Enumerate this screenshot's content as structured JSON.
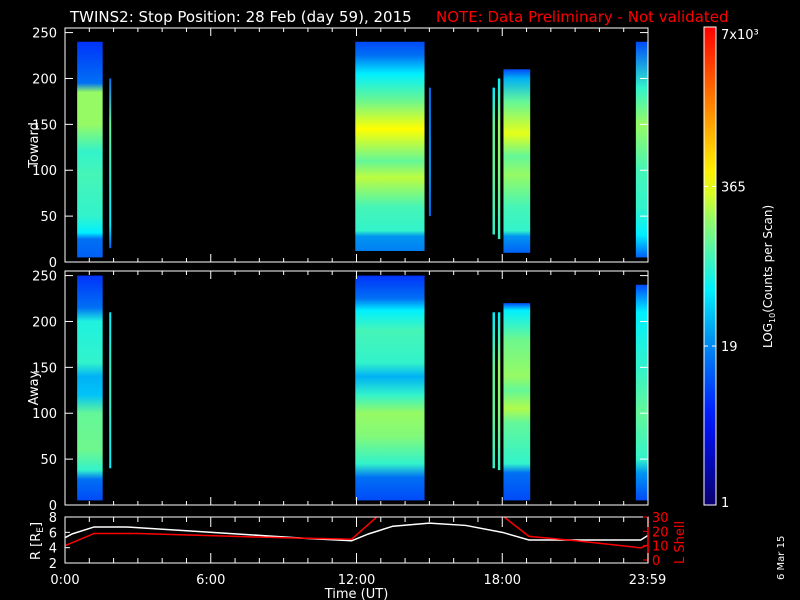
{
  "title": "TWINS2: Stop Position: 28 Feb (day  59), 2015",
  "note": "NOTE: Data Preliminary - Not validated",
  "date_stamp": "6 Mar 15",
  "colors": {
    "note": "#ff0000",
    "axes": "#ffffff",
    "lshell": "#ff0000",
    "radius": "#ffffff"
  },
  "chart_data": [
    {
      "type": "heatmap",
      "panel": "Toward",
      "ylabel": "Toward",
      "ylim": [
        0,
        255
      ],
      "yticks": [
        0,
        50,
        100,
        150,
        200,
        250
      ],
      "xlim_hours": [
        0,
        24
      ],
      "segments": [
        {
          "start": 0.5,
          "end": 1.55,
          "profile": [
            [
              5,
              0.28
            ],
            [
              25,
              0.3
            ],
            [
              32,
              0.45
            ],
            [
              50,
              0.5
            ],
            [
              95,
              0.52
            ],
            [
              120,
              0.5
            ],
            [
              150,
              0.6
            ],
            [
              185,
              0.6
            ],
            [
              195,
              0.3
            ],
            [
              240,
              0.22
            ]
          ]
        },
        {
          "start": 1.82,
          "end": 1.9,
          "profile": [
            [
              15,
              0.28
            ],
            [
              40,
              0.45
            ],
            [
              100,
              0.5
            ],
            [
              150,
              0.55
            ],
            [
              200,
              0.3
            ]
          ]
        },
        {
          "start": 11.95,
          "end": 14.8,
          "profile": [
            [
              12,
              0.32
            ],
            [
              28,
              0.35
            ],
            [
              34,
              0.5
            ],
            [
              60,
              0.52
            ],
            [
              92,
              0.63
            ],
            [
              110,
              0.55
            ],
            [
              145,
              0.68
            ],
            [
              175,
              0.56
            ],
            [
              205,
              0.45
            ],
            [
              225,
              0.3
            ],
            [
              240,
              0.25
            ]
          ]
        },
        {
          "start": 14.98,
          "end": 15.05,
          "profile": [
            [
              50,
              0.3
            ],
            [
              100,
              0.35
            ],
            [
              190,
              0.3
            ]
          ]
        },
        {
          "start": 17.6,
          "end": 17.7,
          "profile": [
            [
              30,
              0.5
            ],
            [
              100,
              0.55
            ],
            [
              150,
              0.55
            ],
            [
              190,
              0.45
            ]
          ]
        },
        {
          "start": 17.82,
          "end": 17.92,
          "profile": [
            [
              25,
              0.5
            ],
            [
              100,
              0.58
            ],
            [
              150,
              0.6
            ],
            [
              200,
              0.45
            ]
          ]
        },
        {
          "start": 18.05,
          "end": 19.15,
          "profile": [
            [
              10,
              0.28
            ],
            [
              28,
              0.35
            ],
            [
              34,
              0.5
            ],
            [
              60,
              0.52
            ],
            [
              95,
              0.6
            ],
            [
              115,
              0.55
            ],
            [
              140,
              0.66
            ],
            [
              175,
              0.55
            ],
            [
              200,
              0.38
            ],
            [
              210,
              0.25
            ]
          ]
        },
        {
          "start": 23.5,
          "end": 24,
          "profile": [
            [
              5,
              0.28
            ],
            [
              30,
              0.45
            ],
            [
              60,
              0.5
            ],
            [
              100,
              0.52
            ],
            [
              150,
              0.6
            ],
            [
              190,
              0.5
            ],
            [
              240,
              0.25
            ]
          ]
        }
      ]
    },
    {
      "type": "heatmap",
      "panel": "Away",
      "ylabel": "Away",
      "ylim": [
        0,
        255
      ],
      "yticks": [
        0,
        50,
        100,
        150,
        200,
        250
      ],
      "xlim_hours": [
        0,
        24
      ],
      "segments": [
        {
          "start": 0.5,
          "end": 1.55,
          "profile": [
            [
              5,
              0.25
            ],
            [
              28,
              0.3
            ],
            [
              38,
              0.5
            ],
            [
              60,
              0.56
            ],
            [
              100,
              0.55
            ],
            [
              120,
              0.4
            ],
            [
              140,
              0.38
            ],
            [
              155,
              0.5
            ],
            [
              200,
              0.48
            ],
            [
              215,
              0.3
            ],
            [
              250,
              0.22
            ]
          ]
        },
        {
          "start": 1.82,
          "end": 1.9,
          "profile": [
            [
              40,
              0.45
            ],
            [
              100,
              0.5
            ],
            [
              150,
              0.5
            ],
            [
              210,
              0.45
            ]
          ]
        },
        {
          "start": 11.95,
          "end": 14.8,
          "profile": [
            [
              5,
              0.25
            ],
            [
              30,
              0.3
            ],
            [
              45,
              0.5
            ],
            [
              75,
              0.58
            ],
            [
              100,
              0.6
            ],
            [
              120,
              0.5
            ],
            [
              140,
              0.38
            ],
            [
              155,
              0.5
            ],
            [
              190,
              0.52
            ],
            [
              212,
              0.45
            ],
            [
              225,
              0.3
            ],
            [
              250,
              0.22
            ]
          ]
        },
        {
          "start": 17.6,
          "end": 17.7,
          "profile": [
            [
              40,
              0.5
            ],
            [
              100,
              0.55
            ],
            [
              150,
              0.55
            ],
            [
              210,
              0.45
            ]
          ]
        },
        {
          "start": 17.82,
          "end": 17.92,
          "profile": [
            [
              38,
              0.5
            ],
            [
              100,
              0.58
            ],
            [
              150,
              0.6
            ],
            [
              210,
              0.45
            ]
          ]
        },
        {
          "start": 18.05,
          "end": 19.15,
          "profile": [
            [
              5,
              0.25
            ],
            [
              35,
              0.3
            ],
            [
              45,
              0.5
            ],
            [
              90,
              0.55
            ],
            [
              105,
              0.62
            ],
            [
              125,
              0.55
            ],
            [
              140,
              0.6
            ],
            [
              180,
              0.56
            ],
            [
              212,
              0.45
            ],
            [
              220,
              0.25
            ]
          ]
        },
        {
          "start": 23.5,
          "end": 24,
          "profile": [
            [
              5,
              0.25
            ],
            [
              35,
              0.35
            ],
            [
              50,
              0.5
            ],
            [
              100,
              0.55
            ],
            [
              150,
              0.5
            ],
            [
              210,
              0.45
            ],
            [
              240,
              0.25
            ]
          ]
        }
      ]
    },
    {
      "type": "line",
      "ylabel": "R [R",
      "ylabel_sub": "E",
      "ylabel_close": "]",
      "ylim": [
        2,
        8
      ],
      "yticks": [
        2,
        4,
        6,
        8
      ],
      "y2label": "L Shell",
      "y2lim": [
        0,
        30
      ],
      "y2ticks": [
        0,
        10,
        20,
        30
      ],
      "xlabel": "Time (UT)",
      "xticks": [
        {
          "h": 0,
          "label": "0:00"
        },
        {
          "h": 6,
          "label": "6:00"
        },
        {
          "h": 12,
          "label": "12:00"
        },
        {
          "h": 18,
          "label": "18:00"
        },
        {
          "h": 23.98,
          "label": "23:59"
        }
      ],
      "series": [
        {
          "name": "R",
          "axis": "left",
          "x": [
            0,
            0.3,
            1.2,
            2.5,
            5,
            8,
            10,
            11.8,
            12.5,
            13.5,
            15,
            16.5,
            18,
            19.1,
            21,
            23.7,
            24
          ],
          "y": [
            5.3,
            5.8,
            6.7,
            6.7,
            6.2,
            5.6,
            5.2,
            4.9,
            5.8,
            6.8,
            7.2,
            6.9,
            6.0,
            5.0,
            5.0,
            5.0,
            5.6
          ]
        },
        {
          "name": "L Shell",
          "axis": "right",
          "x": [
            0,
            1.2,
            3,
            6,
            9,
            11.8,
            12.9
          ],
          "y": [
            10,
            18.5,
            18.5,
            17,
            15.5,
            14.5,
            31
          ]
        },
        {
          "name": "L Shell 2",
          "axis": "right",
          "x": [
            18,
            19.1,
            21,
            23.7,
            24
          ],
          "y": [
            31,
            16.5,
            13.5,
            8.5,
            10.5
          ]
        }
      ]
    },
    {
      "type": "colorbar",
      "label": "LOG",
      "label_sub": "10",
      "label_rest": "(Counts per Scan)",
      "range": [
        1,
        7000
      ],
      "ticks": [
        {
          "v": 1,
          "label": "1"
        },
        {
          "v": 19,
          "label": "19"
        },
        {
          "v": 365,
          "label": "365"
        },
        {
          "v": 7000,
          "label": "7x10³"
        }
      ]
    }
  ]
}
